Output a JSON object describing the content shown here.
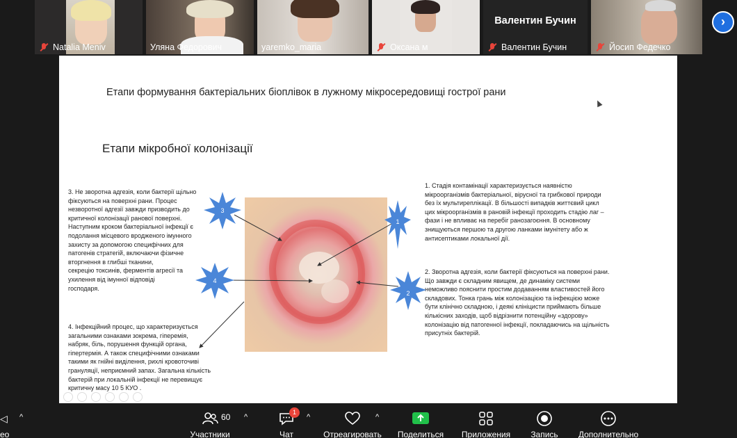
{
  "participants": [
    {
      "name": "Natalia Meniv",
      "muted": true
    },
    {
      "name": "Уляна Федорович",
      "muted": false
    },
    {
      "name": "yaremko_maria",
      "muted": false,
      "active": true
    },
    {
      "name": "Оксана м",
      "muted": true
    },
    {
      "name": "Валентин Бучин",
      "muted": true,
      "display_name": "Валентин Бучин"
    },
    {
      "name": "Йосип Федечко",
      "muted": true
    }
  ],
  "next_page_icon": "chevron-right-icon",
  "slide": {
    "title": "Етапи формування бактеріальних біоплівок  в лужному мікросередовищі  гострої рани",
    "subtitle": "Етапи мікробної колонізації",
    "star_labels": [
      "3",
      "4",
      "1",
      "2"
    ],
    "left_top": [
      "3. Не зворотна адгезія, коли бактерії щільно",
      "фіксуються на поверхні рани. Процес",
      "незворотної адгезії завжди призводить до",
      "критичної колонізації ранової поверхні.",
      "Наступним кроком бактеріальної інфекції є",
      "подолання місцевого вродженого імунного",
      "захисту за допомогою специфічних для",
      "патогенів стратегій, включаючи фізичне",
      "вторгнення в глибші тканини,",
      "секрецію токсинів, ферментів агресії та",
      "ухилення від імунної відповіді",
      "господаря."
    ],
    "left_bottom": [
      "4. Інфекційний процес, що характеризується",
      "загальними ознаками зокрема, гіперемія,",
      "набряк, біль, порушення функцій органа,",
      "гіпертермія. А також специфічними ознаками",
      "такими як гнійні виділення, рихлі кровоточиві",
      "грануляції, неприємний запах. Загальна кількість",
      "бактерій при локальній інфекції не перевищує",
      "критичну масу 10 5 КУО ."
    ],
    "right_top": [
      "1. Стадія контамінації характеризується наявністю",
      "мікроорганізмів бактеріальної, вірусної та грибкової природи",
      "без їх мультиреплікації. В більшості випадків життєвий цикл",
      "цих мікроорганізмів в рановій інфекції проходить стадію лаг –",
      "фази і не впливає на перебіг ранозагоєння. В основному",
      "знищуються першою та другою ланками імунітету або ж",
      "антисептиками локальної дії."
    ],
    "right_bottom": [
      "2. Зворотна  адгезія, коли бактерії фіксуються на поверхні рани.",
      "Що завжди є складним явищем, де динаміку системи",
      "неможливо пояснити простим додаванням властивостей його",
      "складових. Тонка грань між колонізацією та інфекцією може",
      "бути клінічно складною, і деякі клініцисти приймають більше",
      "кількісних заходів, щоб відрізнити потенційну «здорову»",
      "колонізацію від патогенної інфекції, покладаючись на щільність",
      "присутніх бактерій."
    ]
  },
  "toolbar": {
    "left_partial": "ео",
    "participants_label": "Участники",
    "participants_count": "60",
    "chat_label": "Чат",
    "chat_badge": "1",
    "react_label": "Отреагировать",
    "share_label": "Поделиться",
    "apps_label": "Приложения",
    "record_label": "Запись",
    "more_label": "Дополнительно"
  },
  "colors": {
    "accent": "#1f6fe0",
    "share_green": "#21c04a",
    "active_border": "#35d04c",
    "muted_red": "#e8443a",
    "star_blue": "#4a86d8"
  }
}
